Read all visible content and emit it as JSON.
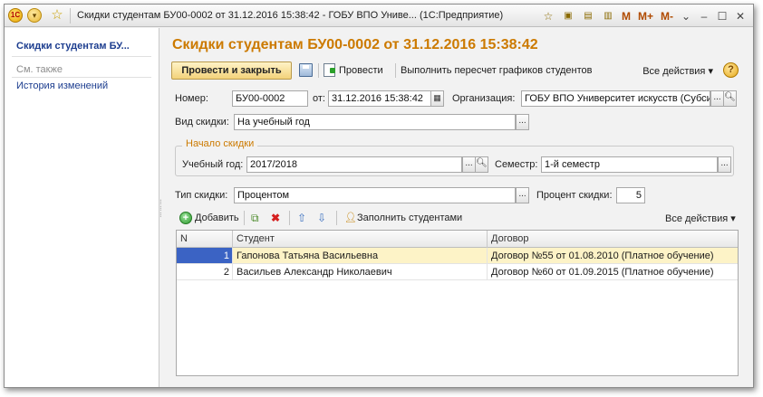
{
  "window": {
    "title": "Скидки студентам БУ00-0002 от 31.12.2016 15:38:42 - ГОБУ ВПО Униве...  (1С:Предприятие)",
    "m_labels": [
      "M",
      "M+",
      "M-"
    ]
  },
  "left_panel": {
    "title": "Скидки студентам БУ...",
    "see_also": "См. также",
    "history": "История изменений"
  },
  "form": {
    "title": "Скидки студентам БУ00-0002 от 31.12.2016 15:38:42",
    "toolbar": {
      "post_close": "Провести и закрыть",
      "post": "Провести",
      "recalc": "Выполнить пересчет графиков студентов",
      "all_actions": "Все действия",
      "help": "?"
    },
    "number_label": "Номер:",
    "number_value": "БУ00-0002",
    "date_label": "от:",
    "date_value": "31.12.2016 15:38:42",
    "org_label": "Организация:",
    "org_value": "ГОБУ ВПО Университет искусств (Субси",
    "discount_kind_label": "Вид скидки:",
    "discount_kind_value": "На учебный год",
    "group_title": "Начало скидки",
    "year_label": "Учебный год:",
    "year_value": "2017/2018",
    "semester_label": "Семестр:",
    "semester_value": "1-й семестр",
    "discount_type_label": "Тип скидки:",
    "discount_type_value": "Процентом",
    "percent_label": "Процент скидки:",
    "percent_value": "5",
    "table_toolbar": {
      "add": "Добавить",
      "fill": "Заполнить студентами",
      "all_actions": "Все действия"
    },
    "table": {
      "columns": [
        "N",
        "Студент",
        "Договор"
      ],
      "rows": [
        {
          "n": "1",
          "student": "Гапонова Татьяна Васильевна",
          "contract": "Договор №55 от 01.08.2010 (Платное обучение)"
        },
        {
          "n": "2",
          "student": "Васильев Александр Николаевич",
          "contract": "Договор №60 от 01.09.2015 (Платное обучение)"
        }
      ]
    }
  },
  "colors": {
    "accent_title": "#cc7a00",
    "link": "#1c3d8f",
    "selection": "#3b63c4",
    "selected_row": "#fdf3c7"
  }
}
